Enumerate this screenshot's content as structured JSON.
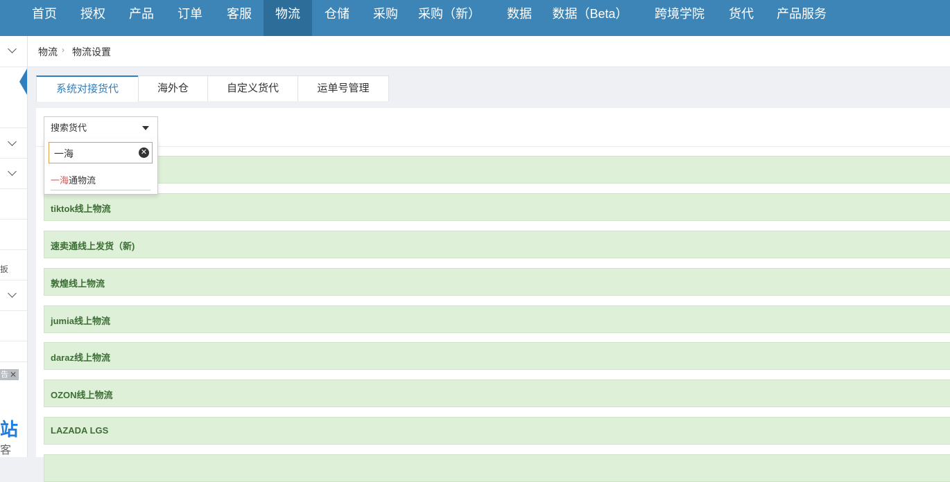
{
  "topnav": {
    "items": [
      {
        "label": "首页"
      },
      {
        "label": "授权"
      },
      {
        "label": "产品"
      },
      {
        "label": "订单"
      },
      {
        "label": "客服"
      },
      {
        "label": "物流"
      },
      {
        "label": "仓储"
      },
      {
        "label": "采购"
      },
      {
        "label": "采购（新）"
      },
      {
        "label": "数据"
      },
      {
        "label": "数据（Beta）"
      },
      {
        "label": "跨境学院"
      },
      {
        "label": "货代"
      },
      {
        "label": "产品服务"
      }
    ],
    "active": "物流"
  },
  "sidebar": {
    "partial_text": "扳",
    "ad": {
      "tag": "告",
      "close": "✕",
      "big": "站",
      "small": "客"
    }
  },
  "breadcrumb": {
    "root": "物流",
    "separator": "›",
    "current": "物流设置"
  },
  "tabs": [
    {
      "label": "系统对接货代"
    },
    {
      "label": "海外仓"
    },
    {
      "label": "自定义货代"
    },
    {
      "label": "运单号管理"
    }
  ],
  "search": {
    "label": "搜索货代",
    "input_value": "一海",
    "result": {
      "highlight": "一海",
      "rest": "通物流"
    }
  },
  "carriers": [
    "",
    "tiktok线上物流",
    "速卖通线上发货（新)",
    "敦煌线上物流",
    "jumia线上物流",
    "daraz线上物流",
    "OZON线上物流",
    "LAZADA LGS"
  ]
}
